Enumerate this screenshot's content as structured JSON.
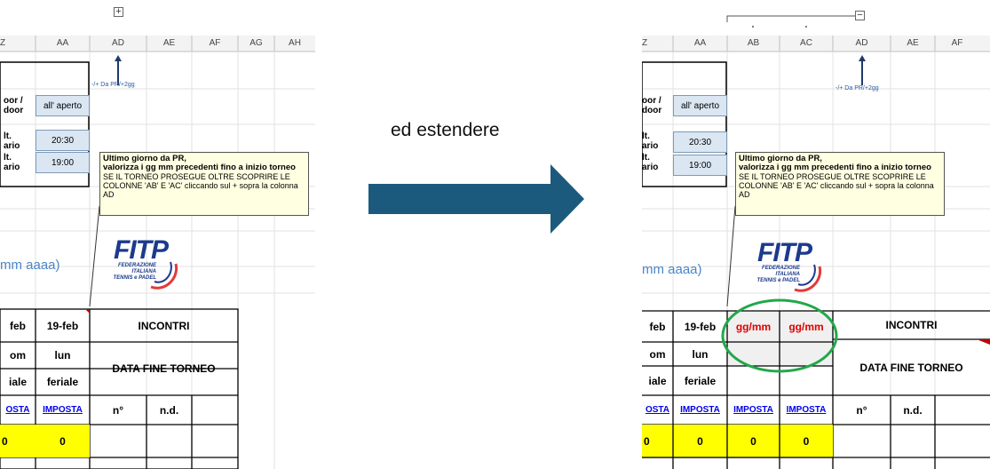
{
  "left": {
    "top_button": "+",
    "columns": [
      "Z",
      "AA",
      "AD",
      "AE",
      "AF",
      "AG",
      "AH"
    ],
    "arrow_note": "-/+ Da PR/+2gg",
    "row_label_1": "oor /\ndoor",
    "row_value_1": "all' aperto",
    "row_label_2": "lt.\nario",
    "row_value_2": "20:30",
    "row_label_3": "lt.\nario",
    "row_value_3": "19:00",
    "note_title": "Ultimo giorno da PR,\nvalorizza i gg mm precedenti fino a inizio torneo",
    "note_body": "SE IL TORNEO PROSEGUE OLTRE SCOPRIRE LE COLONNE 'AB' E 'AC' cliccando sul + sopra la colonna AD",
    "date_hint": "mm aaaa)",
    "logo_text": "FITP",
    "logo_sub": "FEDERAZIONE\nITALIANA\nTENNIS e PADEL",
    "cell_date_a": "feb",
    "cell_date_b": "19-feb",
    "incontri": "INCONTRI",
    "day_a": "om",
    "day_b": "lun",
    "data_fine": "DATA FINE TORNEO",
    "type_a": "iale",
    "type_b": "feriale",
    "imposta_a": "OSTA",
    "imposta_b": "IMPOSTA",
    "n_deg": "n°",
    "nd": "n.d.",
    "zero_a": "0",
    "zero_b": "0"
  },
  "middle": {
    "caption": "ed estendere"
  },
  "right": {
    "top_button": "−",
    "columns": [
      "Z",
      "AA",
      "AB",
      "AC",
      "AD",
      "AE",
      "AF"
    ],
    "arrow_note": "-/+ Da PR/+2gg",
    "row_label_1": "oor /\ndoor",
    "row_value_1": "all' aperto",
    "row_label_2": "lt.\nario",
    "row_value_2": "20:30",
    "row_label_3": "lt.\nario",
    "row_value_3": "19:00",
    "note_title": "Ultimo giorno da PR,\nvalorizza i gg mm precedenti fino a inizio torneo",
    "note_body": "SE IL TORNEO PROSEGUE OLTRE SCOPRIRE LE COLONNE 'AB' E 'AC' cliccando sul + sopra la colonna AD",
    "date_hint": "mm aaaa)",
    "logo_text": "FITP",
    "logo_sub": "FEDERAZIONE\nITALIANA\nTENNIS e PADEL",
    "cell_date_a": "feb",
    "cell_date_b": "19-feb",
    "ggmm_1": "gg/mm",
    "ggmm_2": "gg/mm",
    "incontri": "INCONTRI",
    "day_a": "om",
    "day_b": "lun",
    "data_fine": "DATA FINE TORNEO",
    "type_a": "iale",
    "type_b": "feriale",
    "imposta_a": "OSTA",
    "imposta_b": "IMPOSTA",
    "imposta_c": "IMPOSTA",
    "imposta_d": "IMPOSTA",
    "n_deg": "n°",
    "nd": "n.d.",
    "zero_a": "0",
    "zero_b": "0",
    "zero_c": "0",
    "zero_d": "0"
  },
  "colors": {
    "arrow": "#1c5a7d",
    "circle": "#22a84a",
    "yellow": "#ffff00",
    "fitp_blue": "#1b3a8c",
    "red_text": "#e00000"
  }
}
